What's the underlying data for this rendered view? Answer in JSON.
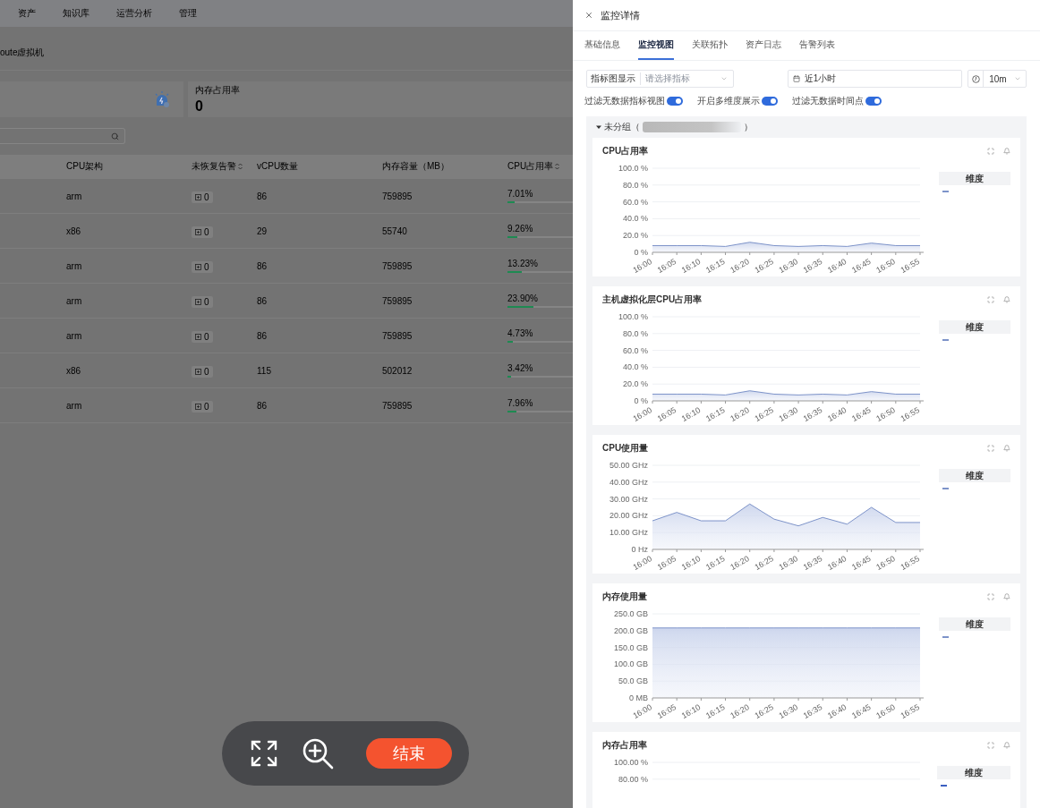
{
  "nav": {
    "items": [
      "资产",
      "知识库",
      "运营分析",
      "管理"
    ]
  },
  "breadcrumb": "oute虚拟机",
  "stats": [
    {
      "kind": "icon"
    },
    {
      "kind": "text",
      "label": "内存占用率",
      "value": "0"
    }
  ],
  "table": {
    "columns": [
      {
        "label": "CPU架构",
        "sortable": false
      },
      {
        "label": "未恢复告警",
        "sortable": true
      },
      {
        "label": "vCPU数量",
        "sortable": false
      },
      {
        "label": "内存容量（MB）",
        "sortable": false
      },
      {
        "label": "CPU占用率",
        "sortable": true
      }
    ],
    "rows": [
      {
        "arch": "arm",
        "alerts": "0",
        "vcpu": "86",
        "memory": "759895",
        "cpu": "7.01%",
        "level": 0.0701
      },
      {
        "arch": "x86",
        "alerts": "0",
        "vcpu": "29",
        "memory": "55740",
        "cpu": "9.26%",
        "level": 0.0926
      },
      {
        "arch": "arm",
        "alerts": "0",
        "vcpu": "86",
        "memory": "759895",
        "cpu": "13.23%",
        "level": 0.1323
      },
      {
        "arch": "arm",
        "alerts": "0",
        "vcpu": "86",
        "memory": "759895",
        "cpu": "23.90%",
        "level": 0.239
      },
      {
        "arch": "arm",
        "alerts": "0",
        "vcpu": "86",
        "memory": "759895",
        "cpu": "4.73%",
        "level": 0.0473
      },
      {
        "arch": "x86",
        "alerts": "0",
        "vcpu": "115",
        "memory": "502012",
        "cpu": "3.42%",
        "level": 0.0342
      },
      {
        "arch": "arm",
        "alerts": "0",
        "vcpu": "86",
        "memory": "759895",
        "cpu": "7.96%",
        "level": 0.0796
      }
    ]
  },
  "drawer": {
    "title": "监控详情",
    "tabs": [
      {
        "label": "基础信息",
        "selected": false
      },
      {
        "label": "监控视图",
        "selected": true
      },
      {
        "label": "关联拓扑",
        "selected": false
      },
      {
        "label": "资产日志",
        "selected": false
      },
      {
        "label": "告警列表",
        "selected": false
      }
    ],
    "metric_select": {
      "label": "指标图显示",
      "placeholder": "请选择指标"
    },
    "time_range": {
      "value": "近1小时"
    },
    "refresh": {
      "value": "10m"
    },
    "toggles": [
      {
        "label": "过滤无数据指标视图",
        "on": true
      },
      {
        "label": "开启多维度展示",
        "on": true
      },
      {
        "label": "过滤无数据时间点",
        "on": true
      }
    ],
    "group": {
      "label": "未分组（",
      "close": "）",
      "expanded": true
    },
    "cards": [
      {
        "legend_header": "维度",
        "chart_data": {
          "type": "area",
          "title": "CPU占用率",
          "grid": true,
          "ylim": [
            0,
            100
          ],
          "yticks": [
            {
              "value": 0,
              "label": "0 %"
            },
            {
              "value": 20,
              "label": "20.0 %"
            },
            {
              "value": 40,
              "label": "40.0 %"
            },
            {
              "value": 60,
              "label": "60.0 %"
            },
            {
              "value": 80,
              "label": "80.0 %"
            },
            {
              "value": 100,
              "label": "100.0 %"
            }
          ],
          "categories": [
            "16:00",
            "16:05",
            "16:10",
            "16:15",
            "16:20",
            "16:25",
            "16:30",
            "16:35",
            "16:40",
            "16:45",
            "16:50",
            "16:55"
          ],
          "series": [
            {
              "color": "#7d93c9",
              "values": [
                8,
                8,
                8,
                7,
                12,
                8,
                7,
                8,
                7,
                11,
                8,
                8
              ]
            }
          ]
        }
      },
      {
        "legend_header": "维度",
        "chart_data": {
          "type": "area",
          "title": "主机虚拟化层CPU占用率",
          "grid": true,
          "ylim": [
            0,
            100
          ],
          "yticks": [
            {
              "value": 0,
              "label": "0 %"
            },
            {
              "value": 20,
              "label": "20.0 %"
            },
            {
              "value": 40,
              "label": "40.0 %"
            },
            {
              "value": 60,
              "label": "60.0 %"
            },
            {
              "value": 80,
              "label": "80.0 %"
            },
            {
              "value": 100,
              "label": "100.0 %"
            }
          ],
          "categories": [
            "16:00",
            "16:05",
            "16:10",
            "16:15",
            "16:20",
            "16:25",
            "16:30",
            "16:35",
            "16:40",
            "16:45",
            "16:50",
            "16:55"
          ],
          "series": [
            {
              "color": "#7d93c9",
              "values": [
                8,
                8,
                8,
                7,
                12,
                8,
                7,
                8,
                7,
                11,
                8,
                8
              ]
            }
          ]
        }
      },
      {
        "legend_header": "维度",
        "chart_data": {
          "type": "area",
          "title": "CPU使用量",
          "grid": true,
          "ylim": [
            0,
            50
          ],
          "yticks": [
            {
              "value": 0,
              "label": "0  Hz"
            },
            {
              "value": 10,
              "label": "10.00  GHz"
            },
            {
              "value": 20,
              "label": "20.00  GHz"
            },
            {
              "value": 30,
              "label": "30.00  GHz"
            },
            {
              "value": 40,
              "label": "40.00  GHz"
            },
            {
              "value": 50,
              "label": "50.00  GHz"
            }
          ],
          "categories": [
            "16:00",
            "16:05",
            "16:10",
            "16:15",
            "16:20",
            "16:25",
            "16:30",
            "16:35",
            "16:40",
            "16:45",
            "16:50",
            "16:55"
          ],
          "series": [
            {
              "color": "#7d93c9",
              "values": [
                17,
                22,
                17,
                17,
                27,
                18,
                14,
                19,
                15,
                25,
                16,
                16
              ]
            }
          ]
        }
      },
      {
        "legend_header": "维度",
        "chart_data": {
          "type": "area",
          "title": "内存使用量",
          "grid": true,
          "ylim": [
            0,
            250
          ],
          "yticks": [
            {
              "value": 0,
              "label": "0  MB"
            },
            {
              "value": 50,
              "label": "50.0  GB"
            },
            {
              "value": 100,
              "label": "100.0  GB"
            },
            {
              "value": 150,
              "label": "150.0  GB"
            },
            {
              "value": 200,
              "label": "200.0  GB"
            },
            {
              "value": 250,
              "label": "250.0  GB"
            }
          ],
          "categories": [
            "16:00",
            "16:05",
            "16:10",
            "16:15",
            "16:20",
            "16:25",
            "16:30",
            "16:35",
            "16:40",
            "16:45",
            "16:50",
            "16:55"
          ],
          "series": [
            {
              "color": "#7d93c9",
              "values": [
                208,
                208,
                208,
                208,
                208,
                208,
                208,
                208,
                208,
                208,
                208,
                208
              ]
            }
          ]
        }
      },
      {
        "legend_header": "维度",
        "title": "内存占用率",
        "y_axis_labels": [
          "100.00 %",
          "80.00 %"
        ]
      }
    ]
  },
  "floating_bar": {
    "end_button": "结束"
  }
}
